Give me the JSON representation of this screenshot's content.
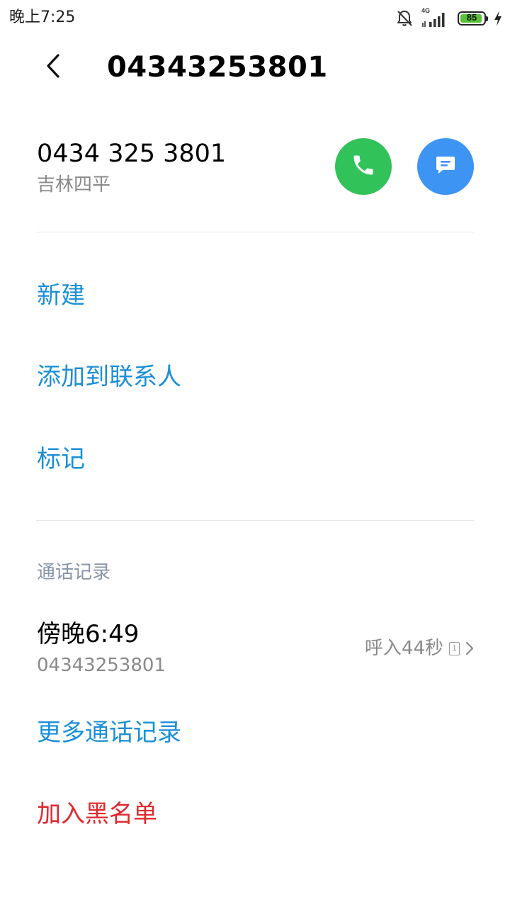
{
  "status_bar": {
    "time": "晚上7:25",
    "network_type": "4G",
    "battery_level": "85",
    "icons": [
      "bell-off-icon",
      "signal-icon",
      "battery-icon",
      "charging-icon"
    ]
  },
  "header": {
    "back_icon": "back-arrow-icon",
    "title": "04343253801"
  },
  "contact": {
    "formatted_number": "0434 325 3801",
    "location": "吉林四平",
    "call_icon": "phone-icon",
    "call_color": "#32c25a",
    "message_icon": "message-icon",
    "message_color": "#3d94f3"
  },
  "actions": {
    "new_label": "新建",
    "add_to_contacts_label": "添加到联系人",
    "mark_label": "标记"
  },
  "call_log": {
    "section_title": "通话记录",
    "entries": [
      {
        "time": "傍晚6:49",
        "number": "04343253801",
        "duration": "呼入44秒",
        "sim": "1"
      }
    ],
    "more_label": "更多通话记录"
  },
  "blacklist": {
    "label": "加入黑名单",
    "color": "#e0292d"
  },
  "colors": {
    "link_blue": "#1c8fd6",
    "secondary_text": "#8a8a8a"
  }
}
